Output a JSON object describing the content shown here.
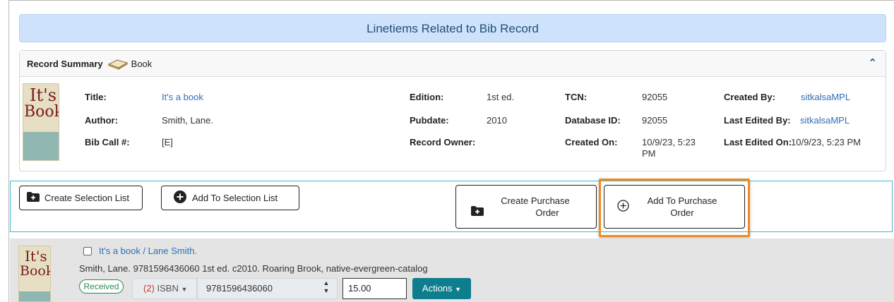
{
  "header": {
    "title": "Linetiems Related to Bib Record"
  },
  "summary": {
    "heading": "Record Summary",
    "format": "Book",
    "cover_text": [
      "It's",
      "Book"
    ],
    "fields": {
      "title_label": "Title:",
      "title_value": "It's a book",
      "author_label": "Author:",
      "author_value": "Smith, Lane.",
      "callno_label": "Bib Call #:",
      "callno_value": "[E]",
      "edition_label": "Edition:",
      "edition_value": "1st ed.",
      "pubdate_label": "Pubdate:",
      "pubdate_value": "2010",
      "owner_label": "Record Owner:",
      "tcn_label": "TCN:",
      "tcn_value": "92055",
      "dbid_label": "Database ID:",
      "dbid_value": "92055",
      "createdon_label": "Created On:",
      "createdon_value": "10/9/23, 5:23 PM",
      "createdby_label": "Created By:",
      "createdby_value": "sitkalsaMPL",
      "editedby_label": "Last Edited By:",
      "editedby_value": "sitkalsaMPL",
      "editedon_label": "Last Edited On:",
      "editedon_value": "10/9/23, 5:23 PM"
    }
  },
  "toolbar": {
    "create_selection_list": "Create Selection List",
    "add_to_selection_list": "Add To Selection List",
    "create_po_line1": "Create Purchase",
    "create_po_line2": "Order",
    "add_po_line1": "Add To Purchase",
    "add_po_line2": "Order"
  },
  "lineitem": {
    "cover_text": [
      "It's",
      "Book"
    ],
    "title_link": "It's a book / Lane Smith.",
    "details": "Smith, Lane. 9781596436060  1st ed. c2010. Roaring Brook, native-evergreen-catalog",
    "status": "Received",
    "ident_count": "(2)",
    "ident_type": "ISBN",
    "ident_value": "9781596436060",
    "price": "15.00",
    "actions_label": "Actions"
  },
  "colors": {
    "accent": "#0e7e8e",
    "highlight": "#f08a24",
    "header_bg": "#cfe2fb",
    "link": "#2f6fb5"
  }
}
